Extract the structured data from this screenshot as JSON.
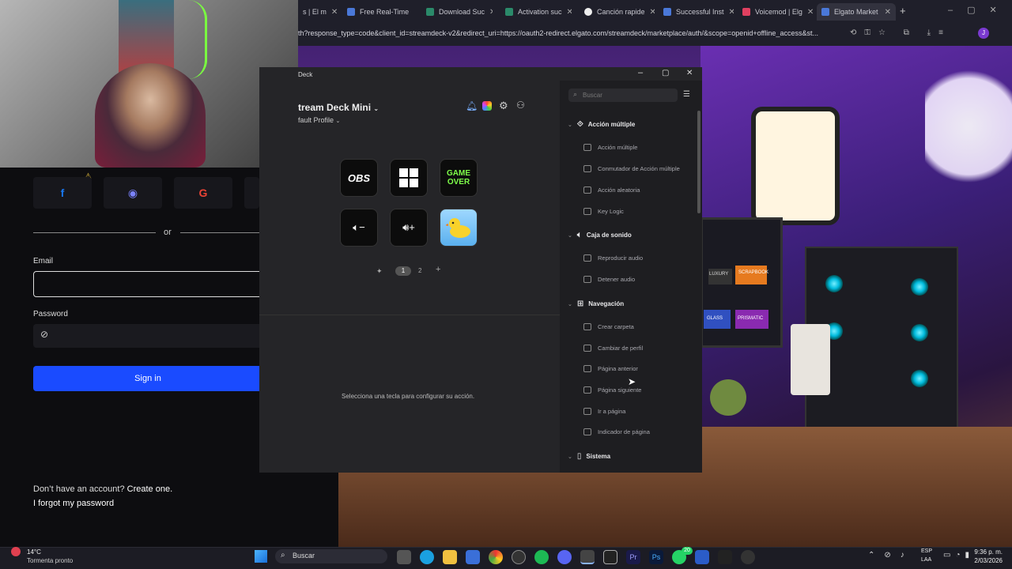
{
  "browser": {
    "tabs": [
      {
        "label": "s | El m",
        "active": false
      },
      {
        "label": "Free Real-Time",
        "active": false
      },
      {
        "label": "Download Suc",
        "active": false
      },
      {
        "label": "Activation suc",
        "active": false
      },
      {
        "label": "Canción rapide",
        "active": false
      },
      {
        "label": "Successful Inst",
        "active": false
      },
      {
        "label": "Voicemod | Elg",
        "active": false
      },
      {
        "label": "Elgato Market",
        "active": true
      }
    ],
    "address": "th?response_type=code&client_id=streamdeck-v2&redirect_uri=https://oauth2-redirect.elgato.com/streamdeck/marketplace/auth/&scope=openid+offline_access&st..."
  },
  "login": {
    "divider": "or",
    "email_label": "Email",
    "email_value": "",
    "password_label": "Password",
    "sign_in": "Sign in",
    "no_account": "Don’t have an account?",
    "create_one": "Create one.",
    "forgot": "I forgot my password"
  },
  "streamdeck": {
    "window_title": "Deck",
    "device": "tream Deck Mini",
    "profile": "fault Profile",
    "keys": [
      {
        "icon": "obs-logo-icon",
        "text": "OBS"
      },
      {
        "icon": "windows-logo-icon",
        "text": ""
      },
      {
        "icon": "game-over-icon",
        "text": "GAME OVER"
      },
      {
        "icon": "volume-down-icon",
        "text": ""
      },
      {
        "icon": "volume-up-icon",
        "text": ""
      },
      {
        "icon": "rubber-duck-icon",
        "text": ""
      }
    ],
    "pages": [
      "1",
      "2"
    ],
    "empty_hint": "Selecciona una tecla para configurar su acción.",
    "search_placeholder": "Buscar",
    "categories": [
      {
        "name": "Acción múltiple",
        "actions": [
          "Acción múltiple",
          "Conmutador de Acción múltiple",
          "Acción aleatoria",
          "Key Logic"
        ]
      },
      {
        "name": "Caja de sonido",
        "actions": [
          "Reproducir audio",
          "Detener audio"
        ]
      },
      {
        "name": "Navegación",
        "actions": [
          "Crear carpeta",
          "Cambiar de perfil",
          "Página anterior",
          "Página siguiente",
          "Ir a página",
          "Indicador de página"
        ]
      },
      {
        "name": "Sistema",
        "actions": []
      }
    ]
  },
  "scene": {
    "pc_labels": [
      "LUXURY",
      "SCRAPBOOK",
      "GLASS",
      "PRISMATIC"
    ]
  },
  "taskbar": {
    "weather_temp": "14°C",
    "weather_desc": "Tormenta pronto",
    "search": "Buscar",
    "lang1": "ESP",
    "lang2": "LAA",
    "time": "9:36 p. m.",
    "date": "2/03/2026",
    "badge": "20"
  }
}
